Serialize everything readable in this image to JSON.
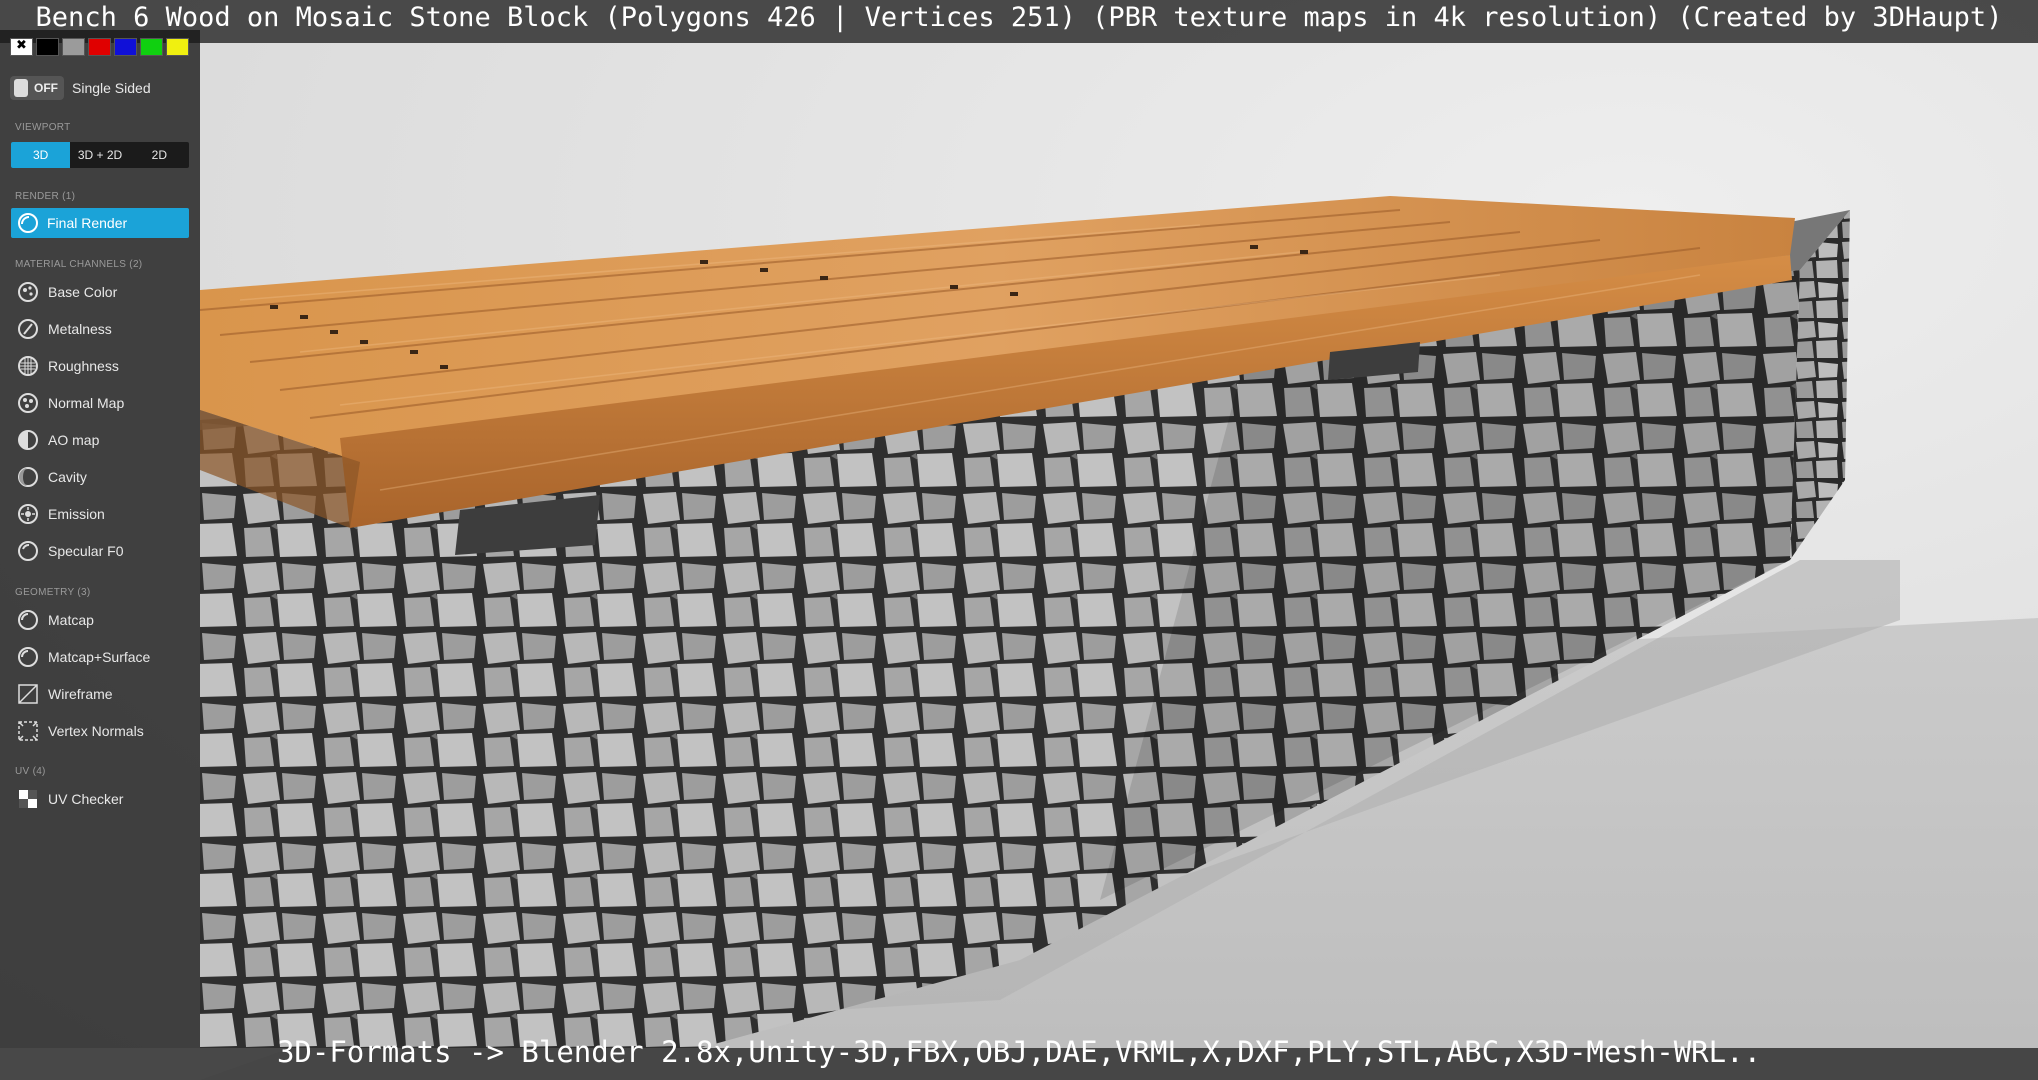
{
  "title": "Bench 6 Wood on Mosaic Stone Block (Polygons 426 | Vertices 251) (PBR texture maps in 4k resolution) (Created by 3DHaupt)",
  "footer": "3D-Formats -> Blender 2.8x,Unity-3D,FBX,OBJ,DAE,VRML,X,DXF,PLY,STL,ABC,X3D-Mesh-WRL..",
  "sidebar": {
    "swatch_colors": [
      "#ffffff",
      "#000000",
      "#9b9b9b",
      "#e00000",
      "#1010d8",
      "#10d010",
      "#f0f010"
    ],
    "single_sided": {
      "toggle_text": "OFF",
      "label": "Single Sided"
    },
    "viewport": {
      "heading": "VIEWPORT",
      "buttons": [
        "3D",
        "3D + 2D",
        "2D"
      ],
      "active": "3D"
    },
    "render": {
      "heading": "RENDER (1)",
      "final_render": "Final Render"
    },
    "material_channels": {
      "heading": "MATERIAL CHANNELS (2)",
      "items": [
        "Base Color",
        "Metalness",
        "Roughness",
        "Normal Map",
        "AO map",
        "Cavity",
        "Emission",
        "Specular F0"
      ]
    },
    "geometry": {
      "heading": "GEOMETRY (3)",
      "items": [
        "Matcap",
        "Matcap+Surface",
        "Wireframe",
        "Vertex Normals"
      ]
    },
    "uv": {
      "heading": "UV (4)",
      "items": [
        "UV Checker"
      ]
    }
  },
  "colors": {
    "accent": "#1ba3d8",
    "wood": "#d08a45",
    "stone": "#8f8f8f"
  }
}
